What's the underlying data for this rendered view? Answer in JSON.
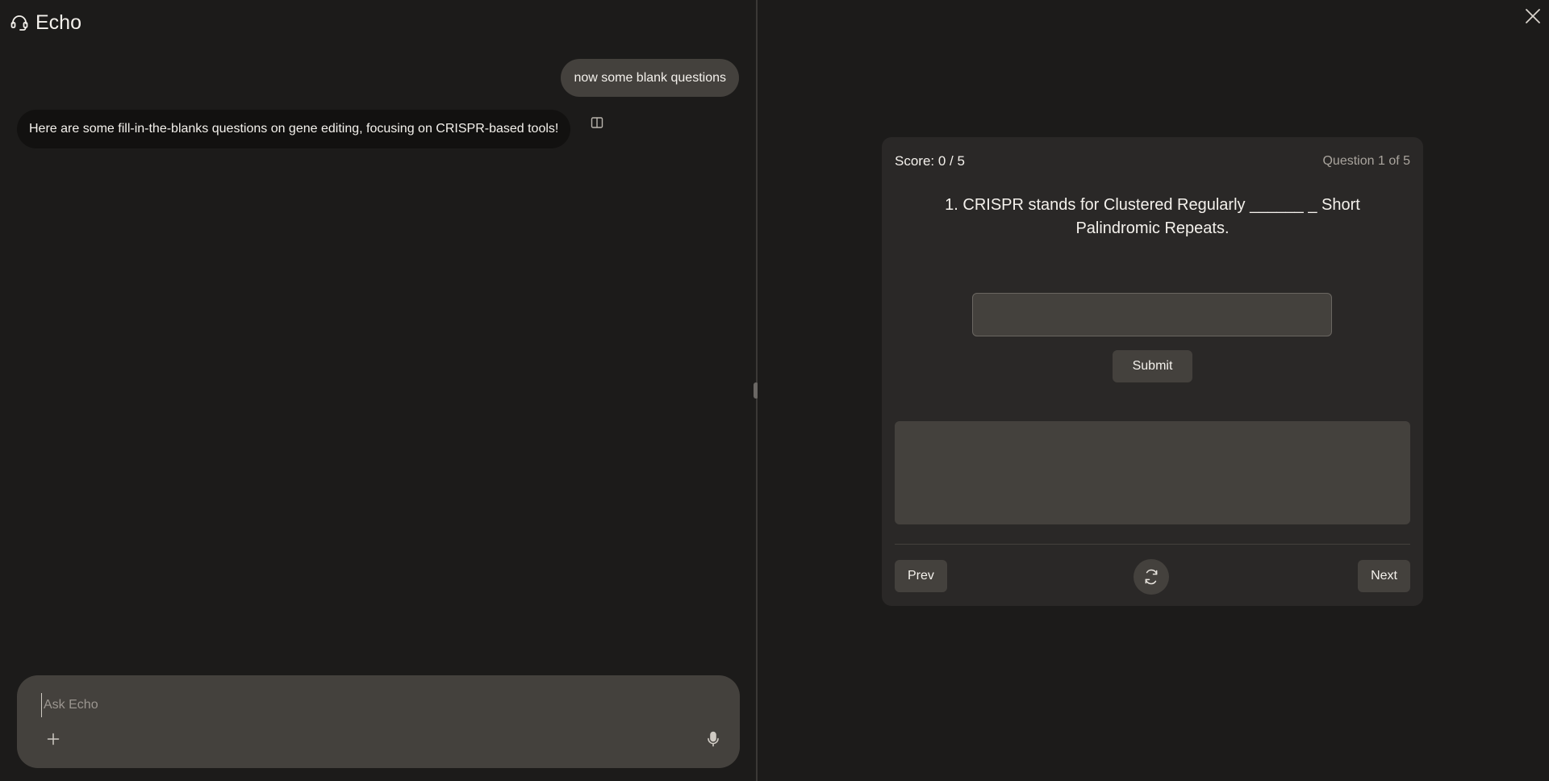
{
  "app": {
    "title": "Echo",
    "icon": "headset-icon"
  },
  "chat": {
    "messages": [
      {
        "role": "user",
        "text": "now some blank questions"
      },
      {
        "role": "assistant",
        "text": "Here are some fill-in-the-blanks questions on gene editing, focusing on CRISPR-based tools!"
      }
    ]
  },
  "composer": {
    "placeholder": "Ask Echo",
    "value": ""
  },
  "quiz": {
    "score_label": "Score:",
    "score_value": "0 / 5",
    "question_counter": "Question 1 of 5",
    "question": "1. CRISPR stands for Clustered Regularly  ______ _ Short Palindromic Repeats.",
    "answer_value": "",
    "submit_label": "Submit",
    "prev_label": "Prev",
    "next_label": "Next"
  },
  "colors": {
    "background": "#1c1b1a",
    "card": "#2a2827",
    "control": "#44413d",
    "text": "#f4f1ec",
    "muted": "#a9a49d"
  }
}
